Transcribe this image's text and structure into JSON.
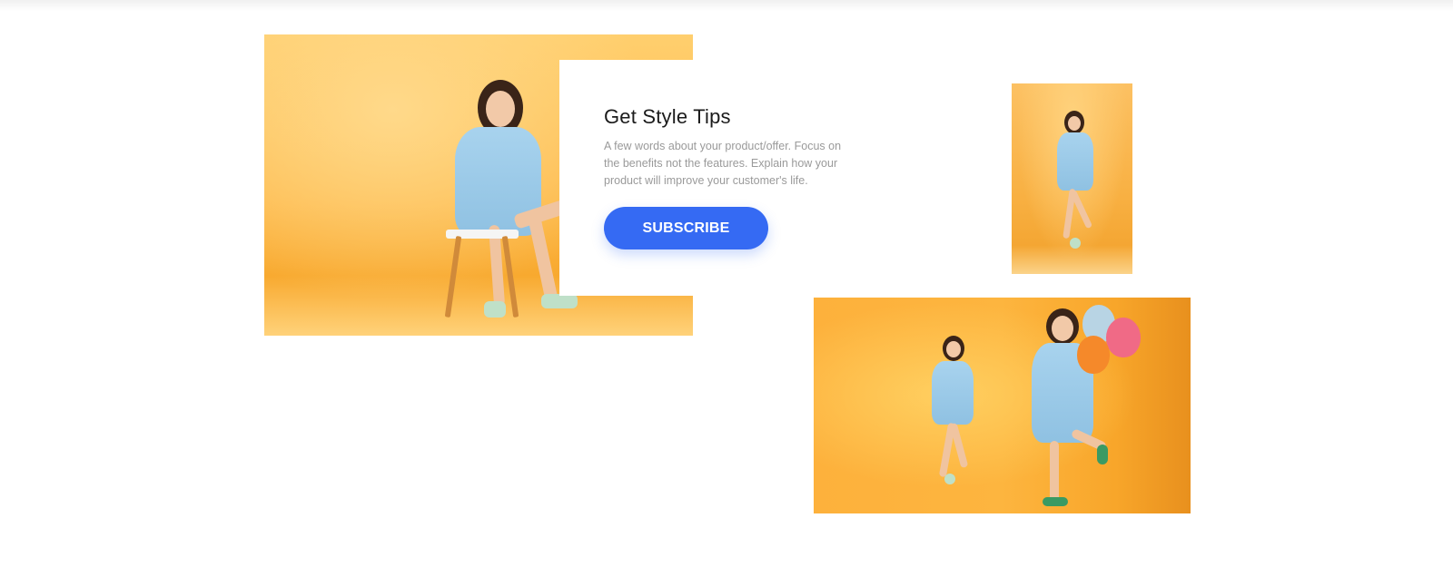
{
  "promo": {
    "title": "Get Style Tips",
    "description": "A few words about your product/offer. Focus on the benefits not the features. Explain how your product will improve your customer's life.",
    "button_label": "SUBSCRIBE"
  },
  "colors": {
    "accent": "#356af3",
    "photo_background": "#fdb94a",
    "text_muted": "#9a9a9a",
    "heading": "#1b1b1b"
  }
}
